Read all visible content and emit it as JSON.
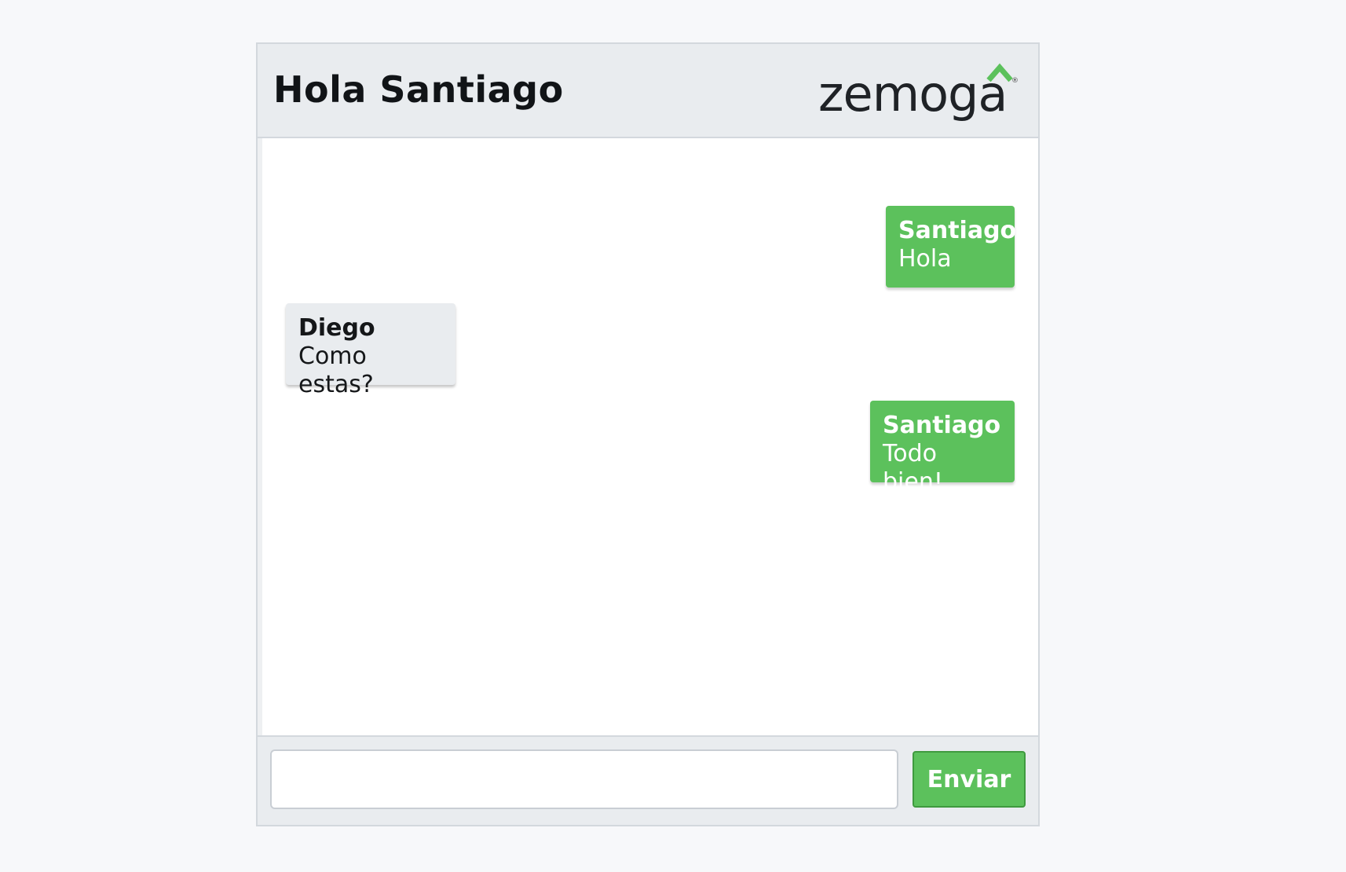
{
  "header": {
    "title": "Hola Santiago",
    "logo_text": "zemoga",
    "logo_registered": "®"
  },
  "messages": [
    {
      "author": "Santiago",
      "text": "Hola",
      "self": true
    },
    {
      "author": "Diego",
      "text": "Como estas?",
      "self": false
    },
    {
      "author": "Santiago",
      "text": "Todo bien!",
      "self": true
    }
  ],
  "composer": {
    "value": "",
    "placeholder": "",
    "send_label": "Enviar"
  },
  "colors": {
    "accent": "#5cc15c",
    "header_bg": "#e9ecef",
    "page_bg": "#f7f8fa"
  },
  "icons": {
    "logo_mark": "chevron-up-icon"
  }
}
